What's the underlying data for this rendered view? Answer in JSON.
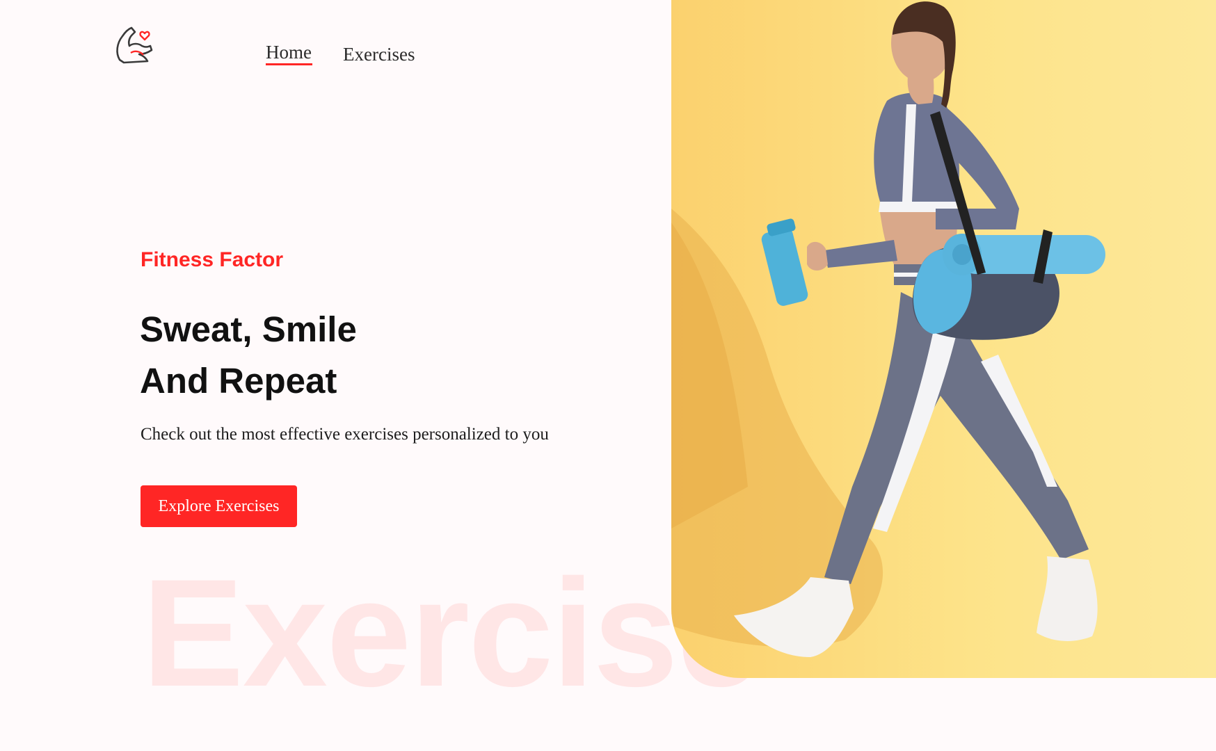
{
  "header": {
    "logo_icon": "flexing-arm-heart-icon",
    "nav": {
      "home_label": "Home",
      "exercises_label": "Exercises"
    }
  },
  "hero": {
    "brand": "Fitness Factor",
    "headline_line1": "Sweat, Smile",
    "headline_line2": "And Repeat",
    "subtitle": "Check out the most effective exercises personalized to you",
    "cta_label": "Explore Exercises",
    "watermark": "Exercise",
    "image_alt": "Woman in athletic wear walking with a gym bag, yoga mat and shaker bottle"
  },
  "colors": {
    "accent": "#ff2625",
    "page_background": "#fffafb",
    "hero_image_background": "#fde389"
  }
}
